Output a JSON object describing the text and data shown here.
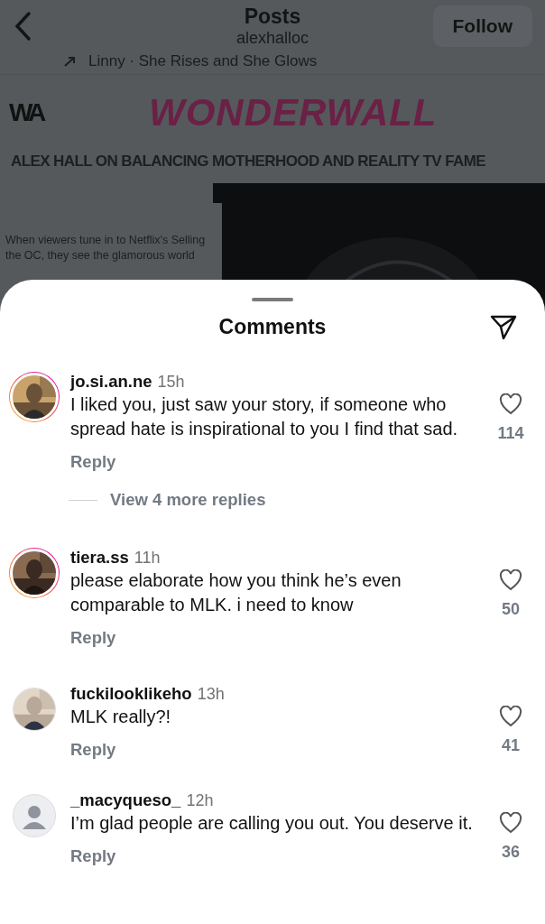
{
  "header": {
    "title": "Posts",
    "subtitle": "alexhalloc",
    "follow_label": "Follow"
  },
  "post": {
    "attribution": "Linny · She Rises and She Glows",
    "logo": "WA",
    "masthead": "WONDERWALL",
    "headline": "ALEX HALL ON BALANCING MOTHERHOOD AND REALITY TV FAME",
    "body": "When viewers tune in to Netflix's Selling the OC, they see the glamorous world"
  },
  "sheet": {
    "title": "Comments"
  },
  "comments": [
    {
      "username": "jo.si.an.ne",
      "time": "15h",
      "text": "I liked you, just saw your story, if someone who spread hate is inspirational to you I find that sad.",
      "likes": "114",
      "liked": false,
      "story": true,
      "reply": "Reply",
      "more_replies": "View 4 more replies"
    },
    {
      "username": "tiera.ss",
      "time": "11h",
      "text": "please elaborate how you think he’s even comparable to MLK. i need to know",
      "likes": "50",
      "liked": false,
      "story": true,
      "reply": "Reply"
    },
    {
      "username": "fuckilooklikeho",
      "time": "13h",
      "text": "MLK really?!",
      "likes": "41",
      "liked": false,
      "story": false,
      "reply": "Reply"
    },
    {
      "username": "_macyqueso_",
      "time": "12h",
      "text": "I’m glad people are calling you out. You deserve it.",
      "likes": "36",
      "liked": false,
      "story": false,
      "avatar": {
        "kind": "default"
      },
      "reply": "Reply"
    }
  ]
}
